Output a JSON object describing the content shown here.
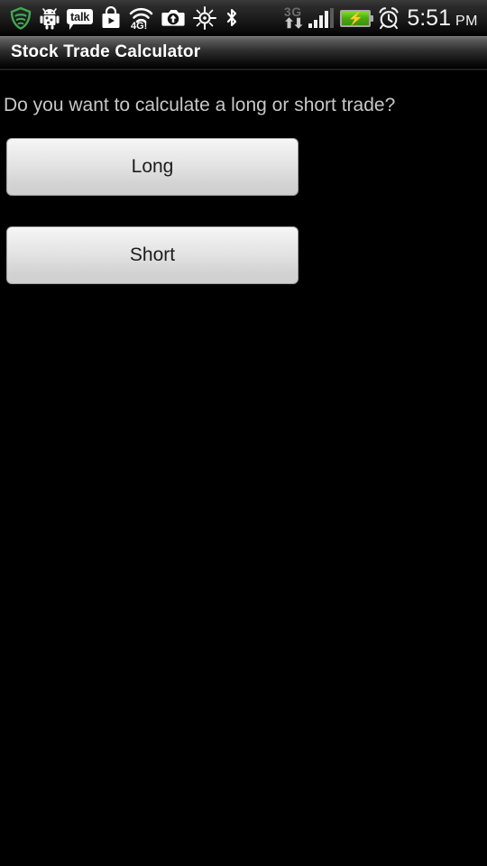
{
  "status_bar": {
    "icons": [
      {
        "name": "lookout-shield-icon",
        "label": "shield"
      },
      {
        "name": "android-robot-icon",
        "label": "android"
      },
      {
        "name": "google-talk-icon",
        "label": "talk"
      },
      {
        "name": "play-store-icon",
        "label": "play-store"
      },
      {
        "name": "wifi-4g-icon",
        "label": "4G!"
      },
      {
        "name": "camera-upload-icon",
        "label": "camera"
      },
      {
        "name": "gps-crosshair-icon",
        "label": "gps"
      },
      {
        "name": "bluetooth-icon",
        "label": "bluetooth"
      }
    ],
    "network": {
      "type_label": "3G",
      "data_arrows": "⬆⬇",
      "signal_bars_filled": 4,
      "signal_bars_total": 5
    },
    "battery": {
      "charging": true,
      "bolt_glyph": "⚡"
    },
    "alarm_set": true,
    "clock": {
      "time": "5:51",
      "period": "PM"
    },
    "colors": {
      "shield_green": "#3faa52",
      "battery_green": "#6fd227",
      "text": "#f2f2f2",
      "dim_text": "#6c6c6c"
    }
  },
  "title_bar": {
    "title": "Stock Trade Calculator"
  },
  "main": {
    "prompt": "Do you want to calculate a long or short trade?",
    "buttons": [
      {
        "id": "long",
        "label": "Long"
      },
      {
        "id": "short",
        "label": "Short"
      }
    ],
    "colors": {
      "background": "#000000",
      "prompt_text": "#c8c8c8",
      "button_text": "#1c1c1c",
      "button_top": "#f6f6f6",
      "button_bottom": "#cfcfcf"
    }
  }
}
